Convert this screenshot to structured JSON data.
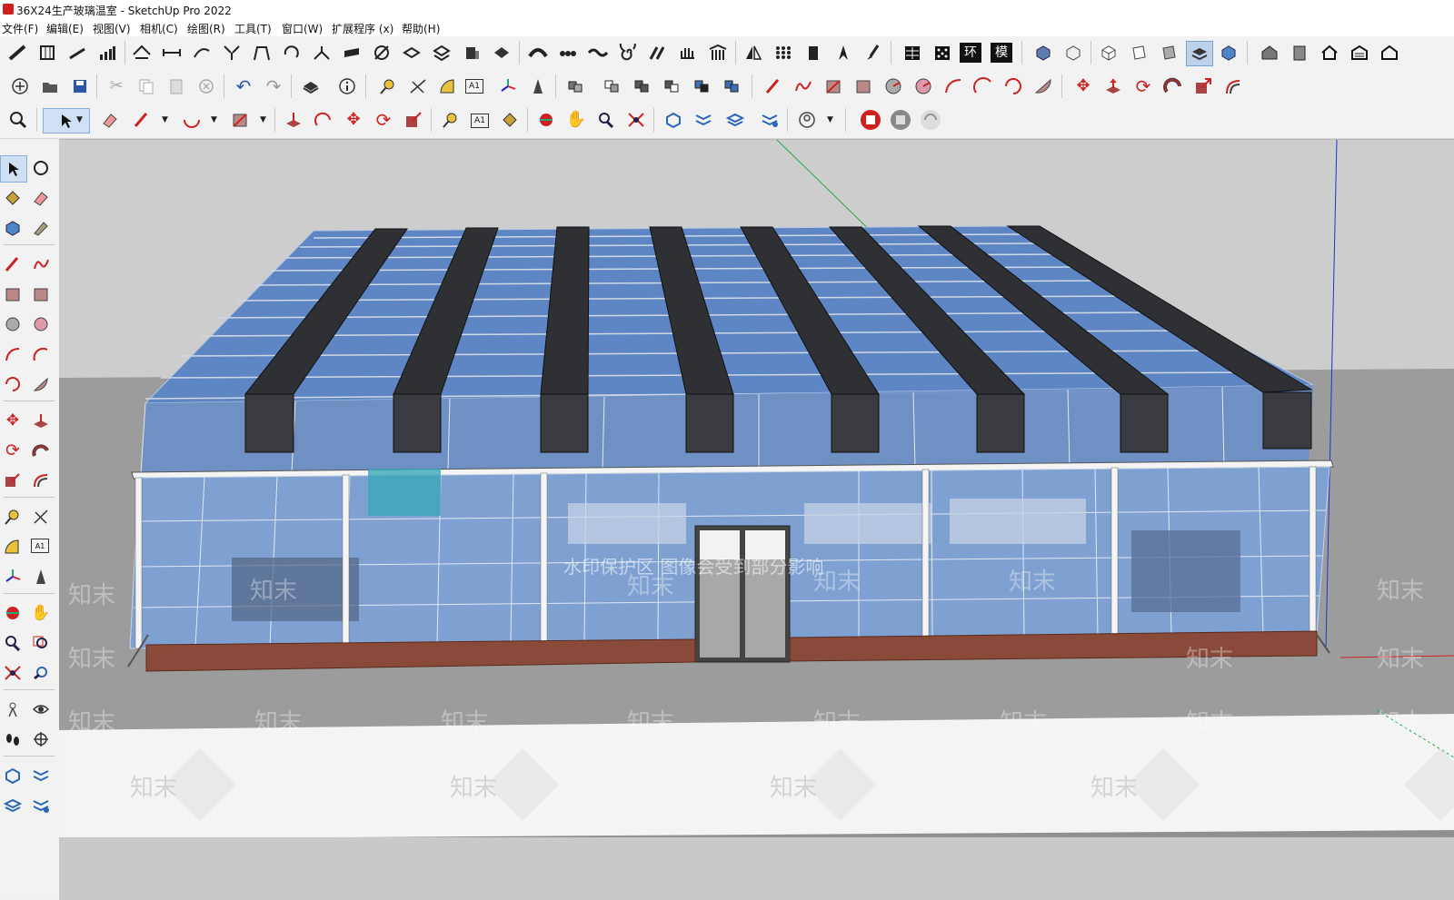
{
  "window": {
    "title": "36X24生产玻璃温室 - SketchUp Pro 2022"
  },
  "menu": [
    "文件(F)",
    "编辑(E)",
    "视图(V)",
    "相机(C)",
    "绘图(R)",
    "工具(T)",
    "窗口(W)",
    "扩展程序 (x)",
    "帮助(H)"
  ],
  "toolbar_row1": {
    "icons": [
      "stairs-icon",
      "grid-panel-icon",
      "ramp-icon",
      "bar-steps-icon",
      "roof-truss-icon",
      "beam-icon",
      "sweep-icon",
      "arrows-in-icon",
      "frame-icon",
      "rotate-curve-icon",
      "split-icon",
      "slab-icon",
      "pencil-line-icon",
      "stack-icon",
      "explode-stack-icon",
      "box-icon",
      "cut-shape-icon",
      "arc-bar-icon",
      "chain-icon",
      "wave-icon",
      "spiral-icon",
      "bars-slant-icon",
      "hand-grab-icon",
      "pillars-icon",
      "mirror-icon",
      "dots-grid-icon",
      "panel-icon",
      "arrow-pen-icon",
      "brush-icon",
      "table-icon",
      "dice-icon",
      "huan-icon",
      "mo-icon",
      "iso-cube-icon",
      "iso-box-icon",
      "top-view-icon",
      "side-view-icon",
      "back-view-icon",
      "layers-view-icon",
      "blue-cube-icon",
      "house-icon",
      "door-icon",
      "home-icon",
      "garage-icon",
      "house-outline-icon"
    ],
    "labels": {
      "huan": "环",
      "mo": "模"
    }
  },
  "toolbar_row2": {
    "icons": [
      "new-file-icon",
      "open-folder-icon",
      "save-icon",
      "scissors-icon",
      "copy-icon",
      "paste-icon",
      "delete-icon",
      "undo-icon",
      "redo-icon",
      "print-icon",
      "info-icon",
      "tape-measure-icon",
      "dimension-icon",
      "protractor-icon",
      "text-icon",
      "axes-icon",
      "3d-text-icon",
      "component-icon",
      "group-icon",
      "solid-union-icon",
      "solid-subtract-icon",
      "solid-trim-icon",
      "solid-split-icon",
      "pencil-icon",
      "freehand-icon",
      "rectangle-icon",
      "rotated-rect-icon",
      "circle-icon",
      "polygon-icon",
      "arc-icon",
      "arc-2pt-icon",
      "arc-3pt-icon",
      "pie-icon",
      "move-icon",
      "push-pull-icon",
      "rotate-icon",
      "follow-me-icon",
      "scale-icon",
      "offset-icon"
    ],
    "labels": {
      "text": "A1"
    }
  },
  "toolbar_row3": {
    "icons": [
      "zoom-icon",
      "select-icon",
      "eraser-icon",
      "pencil-icon",
      "arc-icon",
      "rectangle-icon",
      "push-pull-icon",
      "follow-me-icon",
      "move-icon",
      "rotate-icon",
      "scale-icon",
      "tape-measure-icon",
      "text-icon",
      "paint-bucket-icon",
      "orbit-icon",
      "pan-icon",
      "zoom-window-icon",
      "zoom-extents-icon",
      "warehouse-icon",
      "extension-icon",
      "layers-icon",
      "settings-icon",
      "profile-icon",
      "red-cube-icon",
      "gray-cube-icon",
      "sync-icon"
    ],
    "labels": {
      "text": "A1"
    }
  },
  "left_toolbar": {
    "icons": [
      "select-icon",
      "orbit-icon",
      "paint-bucket-icon",
      "eraser-icon",
      "component-icon",
      "tag-icon",
      "pencil-icon",
      "freehand-icon",
      "rectangle-icon",
      "rotated-rect-icon",
      "circle-icon",
      "polygon-icon",
      "arc-icon",
      "arc-2pt-icon",
      "arc-3pt-icon",
      "pie-icon",
      "move-icon",
      "push-pull-icon",
      "rotate-icon",
      "follow-me-icon",
      "scale-icon",
      "offset-icon",
      "tape-measure-icon",
      "dimension-icon",
      "protractor-icon",
      "text-icon",
      "axes-icon",
      "3d-text-icon",
      "section-plane-icon",
      "pan-icon",
      "zoom-icon",
      "zoom-window-icon",
      "zoom-extents-icon",
      "previous-view-icon",
      "position-camera-icon",
      "look-around-icon",
      "walk-icon",
      "compass-icon",
      "warehouse-icon",
      "extension-icon",
      "layers-icon",
      "settings-icon"
    ],
    "labels": {
      "text": "A1"
    }
  },
  "scene": {
    "watermark_text": "知末",
    "notice_text": "水印保护区  图像会受到部分影响",
    "colors": {
      "ground": "#9a9a9a",
      "glass": "#6f93c6",
      "shade": "#2e2f33",
      "brick": "#8a4a3a"
    }
  }
}
